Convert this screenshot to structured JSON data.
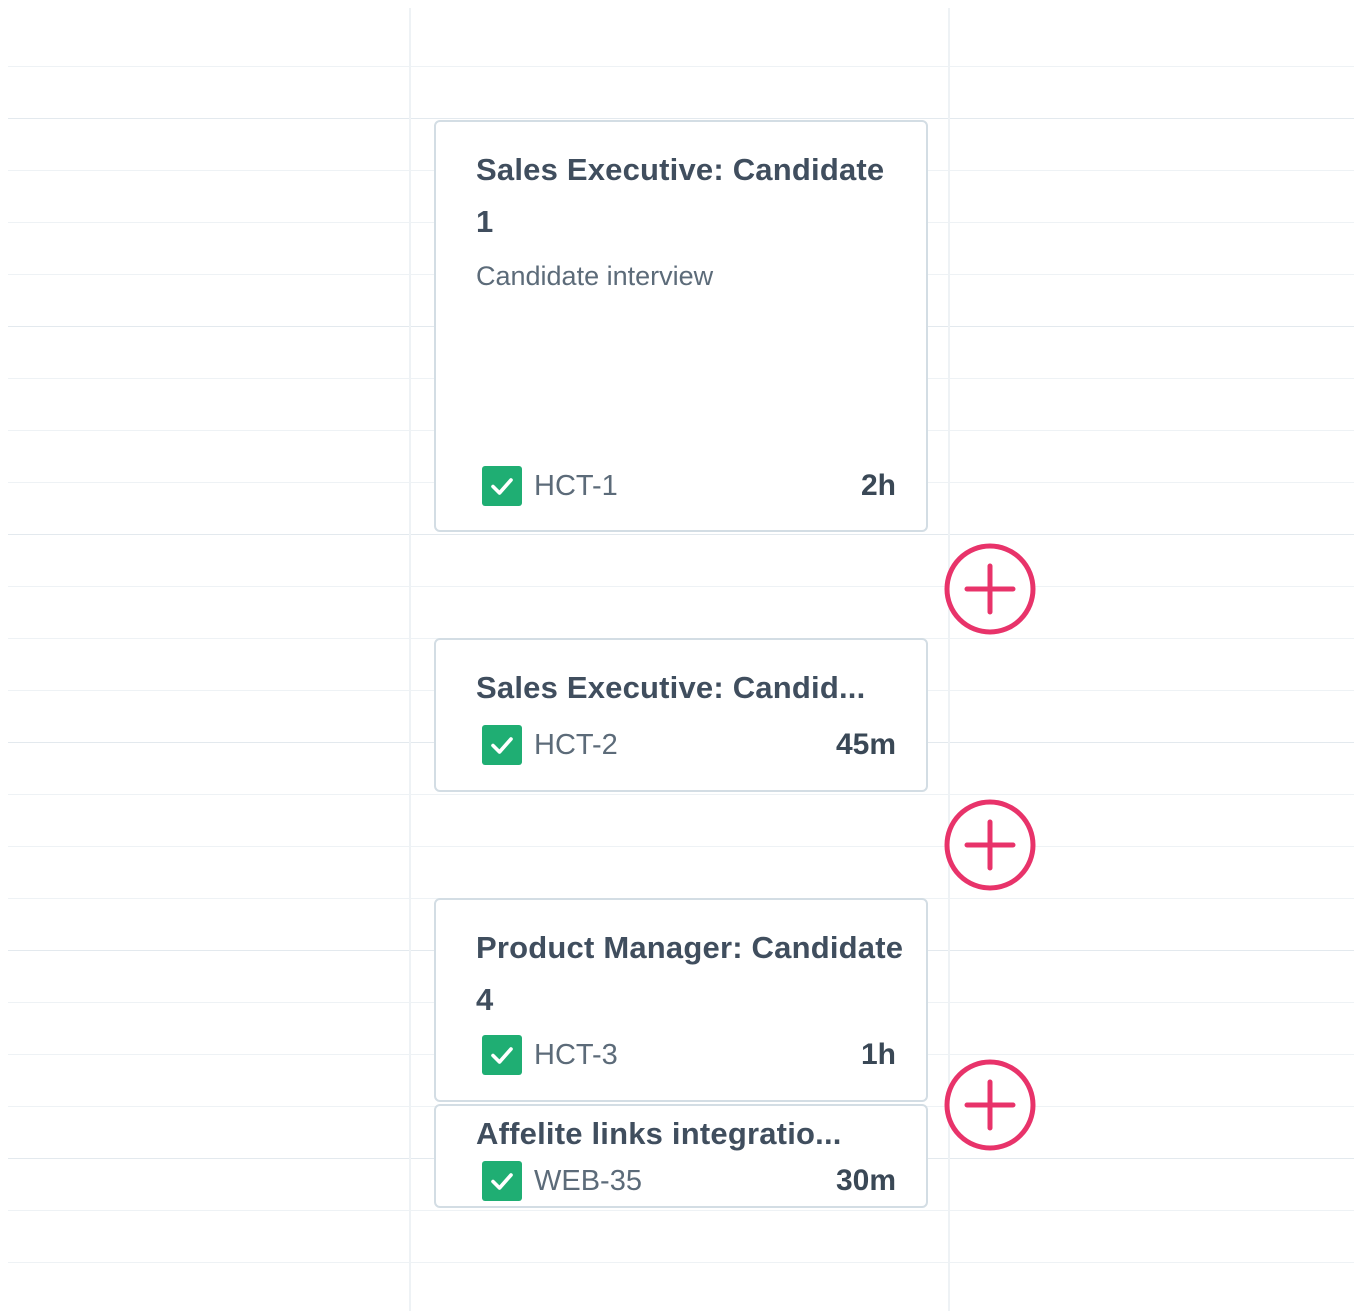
{
  "events": [
    {
      "title": "Sales Executive: Candidate 1",
      "subtitle": "Candidate interview",
      "key": "HCT-1",
      "duration": "2h"
    },
    {
      "title": "Sales Executive: Candid...",
      "key": "HCT-2",
      "duration": "45m"
    },
    {
      "title": "Product Manager: Candidate 4",
      "key": "HCT-3",
      "duration": "1h"
    },
    {
      "title": "Affelite links integratio...",
      "key": "WEB-35",
      "duration": "30m"
    }
  ],
  "colors": {
    "check": "#1fae73",
    "add_button": "#e8336a",
    "card_border": "#d3dde4",
    "grid_line": "#eef2f5"
  },
  "icons": {
    "status": "check-icon",
    "add": "plus-circle-icon"
  }
}
